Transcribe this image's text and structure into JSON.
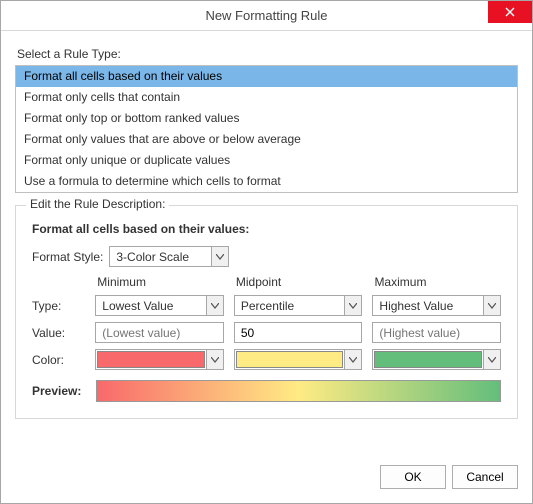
{
  "window": {
    "title": "New Formatting Rule"
  },
  "ruleType": {
    "label": "Select a Rule Type:",
    "items": [
      "Format all cells based on their values",
      "Format only cells that contain",
      "Format only top or bottom ranked values",
      "Format only values that are above or below average",
      "Format only unique or duplicate values",
      "Use a formula to determine which cells to format"
    ],
    "selectedIndex": 0
  },
  "description": {
    "legend": "Edit the Rule Description:",
    "title": "Format all cells based on their values:",
    "formatStyle": {
      "label": "Format Style:",
      "value": "3-Color Scale"
    },
    "columns": {
      "minimum": "Minimum",
      "midpoint": "Midpoint",
      "maximum": "Maximum"
    },
    "rows": {
      "type": {
        "label": "Type:",
        "min": "Lowest Value",
        "mid": "Percentile",
        "max": "Highest Value"
      },
      "value": {
        "label": "Value:",
        "minPlaceholder": "(Lowest value)",
        "mid": "50",
        "maxPlaceholder": "(Highest value)"
      },
      "color": {
        "label": "Color:",
        "min": "#f8696b",
        "mid": "#ffeb84",
        "max": "#63be7b"
      }
    },
    "previewLabel": "Preview:"
  },
  "buttons": {
    "ok": "OK",
    "cancel": "Cancel"
  }
}
